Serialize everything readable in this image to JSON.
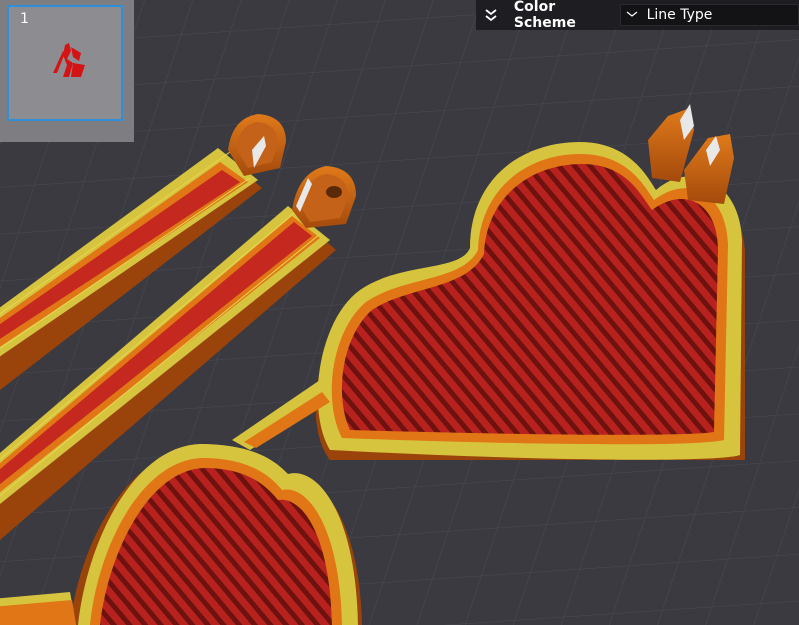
{
  "plate_thumbnail": {
    "index": "1",
    "icon": "model-preview-icon"
  },
  "color_scheme": {
    "label": "Color Scheme",
    "selected": "Line Type",
    "collapse_icon": "double-chevron-down-icon",
    "dropdown_icon": "chevron-down-icon"
  },
  "colors": {
    "background": "#3a3a40",
    "grid": "#4a4a50",
    "infill": "#8c1b18",
    "infill_line": "#c52a24",
    "outer_wall": "#e27316",
    "inner_wall": "#d8c640",
    "panel_bg": "#1e1e22",
    "selection_border": "#2f8fd8"
  }
}
